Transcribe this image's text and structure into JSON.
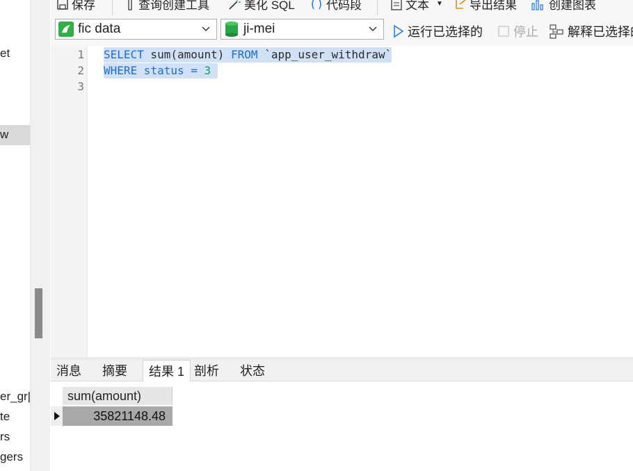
{
  "left_pane": {
    "items": [
      "et",
      "w",
      "er_gr|",
      "te",
      "rs",
      "gers"
    ]
  },
  "toolbar_top": {
    "save": "保存",
    "query_builder": "查询创建工具",
    "beautify": "美化 SQL",
    "snippet": "代码段",
    "text": "文本",
    "export": "导出结果",
    "chart": "创建图表"
  },
  "toolbar": {
    "connection_value": "fic data",
    "database_value": "ji-mei",
    "run_selected": "运行已选择的",
    "stop": "停止",
    "explain_selected": "解释已选择的"
  },
  "editor": {
    "line_numbers": [
      "1",
      "2",
      "3"
    ],
    "line1": {
      "kw1": "SELECT",
      "mid": " sum(amount) ",
      "kw2": "FROM",
      "table": " `app_user_withdraw`"
    },
    "line2": {
      "kw1": "WHERE",
      "col": " status ",
      "op": "=",
      "num": " 3"
    }
  },
  "result_tabs": [
    "消息",
    "摘要",
    "结果 1",
    "剖析",
    "状态"
  ],
  "active_tab": "结果 1",
  "grid": {
    "columns": [
      "sum(amount)"
    ],
    "rows": [
      [
        "35821148.48"
      ]
    ]
  },
  "colors": {
    "keyword": "#1e6bd6",
    "number": "#1a9a5a",
    "selection": "#cfe0f7"
  }
}
